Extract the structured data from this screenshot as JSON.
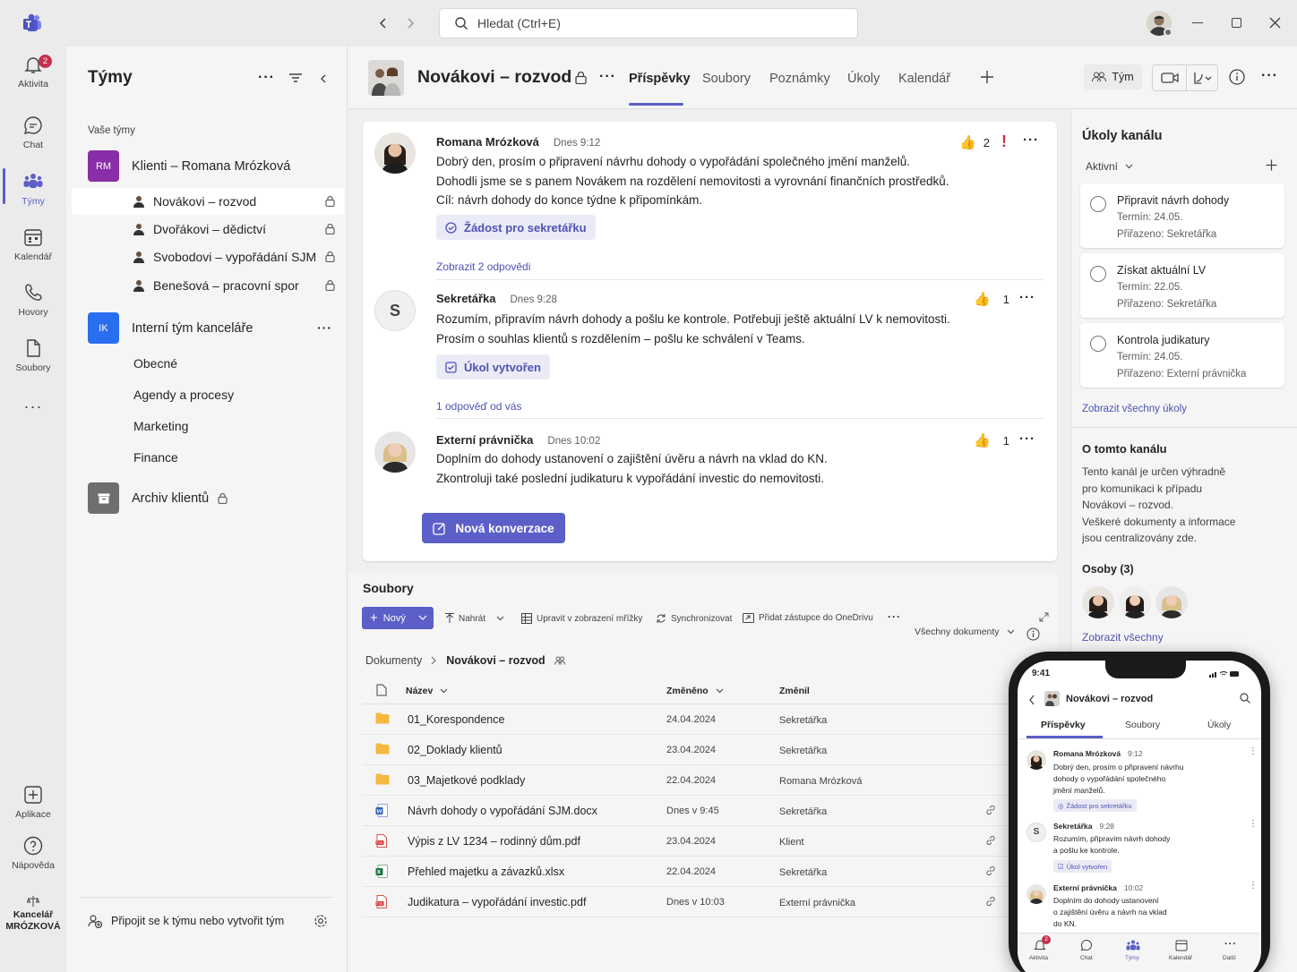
{
  "app": {
    "search_placeholder": "Hledat (Ctrl+E)"
  },
  "rail": {
    "items": [
      {
        "label": "Aktivita",
        "badge": "2"
      },
      {
        "label": "Chat"
      },
      {
        "label": "Týmy"
      },
      {
        "label": "Kalendář"
      },
      {
        "label": "Hovory"
      },
      {
        "label": "Soubory"
      },
      {
        "label": "Aplikace"
      },
      {
        "label": "Nápověda"
      }
    ],
    "org_line1": "Kancelář",
    "org_line2": "MRÓZKOVÁ"
  },
  "teams": {
    "title": "Týmy",
    "section_label": "Vaše týmy",
    "team1": {
      "initials": "RM",
      "name": "Klienti – Romana Mrózková",
      "channels": [
        "Novákovi – rozvod",
        "Dvořákovi – dědictví",
        "Svobodovi – vypořádání SJM",
        "Benešová – pracovní spor"
      ]
    },
    "team2": {
      "initials": "IK",
      "name": "Interní tým kanceláře",
      "channels": [
        "Obecné",
        "Agendy a procesy",
        "Marketing",
        "Finance"
      ]
    },
    "team3": {
      "name": "Archiv klientů"
    },
    "footer": "Připojit se k týmu nebo vytvořit tým"
  },
  "channel": {
    "name": "Novákovi – rozvod",
    "tabs": [
      "Příspěvky",
      "Soubory",
      "Poznámky",
      "Úkoly",
      "Kalendář"
    ],
    "team_button": "Tým"
  },
  "posts": [
    {
      "author": "Romana Mrózková",
      "time": "Dnes 9:12",
      "lines": [
        "Dobrý den, prosím o připravení návrhu dohody o vypořádání společného jmění manželů.",
        "Dohodli jsme se s panem Novákem na rozdělení nemovitosti a vyrovnání finančních prostředků.",
        "Cíl: návrh dohody do konce týdne k připomínkám."
      ],
      "chip": "Žádost pro sekretářku",
      "reactions": "2",
      "replies": "Zobrazit 2 odpovědi"
    },
    {
      "author": "Sekretářka",
      "initial": "S",
      "time": "Dnes 9:28",
      "lines": [
        "Rozumím, připravím návrh dohody a pošlu ke kontrole. Potřebuji ještě aktuální LV k nemovitosti.",
        "Prosím o souhlas klientů s rozdělením – pošlu ke schválení v Teams."
      ],
      "chip": "Úkol vytvořen",
      "reactions": "1",
      "replies": "1 odpověď od vás"
    },
    {
      "author": "Externí právnička",
      "time": "Dnes 10:02",
      "lines": [
        "Doplním do dohody ustanovení o zajištění úvěru a návrh na vklad do KN.",
        "Zkontroluji také poslední judikaturu k vypořádání investic do nemovitosti."
      ],
      "reactions": "1"
    }
  ],
  "new_conversation": "Nová konverzace",
  "files": {
    "title": "Soubory",
    "toolbar": {
      "new": "Nový",
      "upload": "Nahrát",
      "grid": "Upravit v zobrazení mřížky",
      "sync": "Synchronizovat",
      "shortcut": "Přidat zástupce do OneDrivu",
      "view": "Všechny dokumenty"
    },
    "breadcrumb": {
      "root": "Dokumenty",
      "current": "Novákovi – rozvod"
    },
    "columns": {
      "name": "Název",
      "modified": "Změněno",
      "modified_by": "Změnil"
    },
    "rows": [
      {
        "name": "01_Korespondence",
        "modified": "24.04.2024",
        "by": "Sekretářka",
        "type": "folder"
      },
      {
        "name": "02_Doklady klientů",
        "modified": "23.04.2024",
        "by": "Sekretářka",
        "type": "folder"
      },
      {
        "name": "03_Majetkové podklady",
        "modified": "22.04.2024",
        "by": "Romana Mrózková",
        "type": "folder"
      },
      {
        "name": "Návrh dohody o vypořádání SJM.docx",
        "modified": "Dnes v 9:45",
        "by": "Sekretářka",
        "type": "word"
      },
      {
        "name": "Výpis z LV 1234 – rodinný dům.pdf",
        "modified": "23.04.2024",
        "by": "Klient",
        "type": "pdf"
      },
      {
        "name": "Přehled majetku a závazků.xlsx",
        "modified": "22.04.2024",
        "by": "Sekretářka",
        "type": "excel"
      },
      {
        "name": "Judikatura – vypořádání investic.pdf",
        "modified": "Dnes v 10:03",
        "by": "Externí právnička",
        "type": "pdf"
      }
    ]
  },
  "tasks_panel": {
    "title": "Úkoly kanálu",
    "filter": "Aktivní",
    "tasks": [
      {
        "title": "Připravit návrh dohody",
        "due": "Termín: 24.05.",
        "assigned": "Přiřazeno: Sekretářka"
      },
      {
        "title": "Získat aktuální LV",
        "due": "Termín: 22.05.",
        "assigned": "Přiřazeno: Sekretářka"
      },
      {
        "title": "Kontrola judikatury",
        "due": "Termín: 24.05.",
        "assigned": "Přiřazeno: Externí právnička"
      }
    ],
    "show_all": "Zobrazit všechny úkoly"
  },
  "about": {
    "title": "O tomto kanálu",
    "lines": [
      "Tento kanál je určen výhradně",
      "pro komunikaci k případu",
      "Novákovi – rozvod.",
      "Veškeré dokumenty a informace",
      "jsou centralizovány zde."
    ],
    "people_label": "Osoby (3)",
    "show_all": "Zobrazit všechny"
  },
  "phone": {
    "time": "9:41",
    "channel": "Novákovi – rozvod",
    "tabs": [
      "Příspěvky",
      "Soubory",
      "Úkoly"
    ],
    "posts": [
      {
        "author": "Romana Mrózková",
        "time": "9:12",
        "lines": [
          "Dobrý den, prosím o připravení návrhu",
          "dohody o vypořádání společného",
          "jmění manželů."
        ],
        "chip": "Žádost pro sekretářku"
      },
      {
        "author": "Sekretářka",
        "time": "9:28",
        "lines": [
          "Rozumím, připravím návrh dohody",
          "a pošlu ke kontrole."
        ],
        "chip": "Úkol vytvořen"
      },
      {
        "author": "Externí právnička",
        "time": "10:02",
        "lines": [
          "Doplním do dohody ustanovení",
          "o zajištění úvěru a návrh na vklad",
          "do KN."
        ]
      }
    ],
    "nav": [
      "Aktivita",
      "Chat",
      "Týmy",
      "Kalendář",
      "Další"
    ],
    "badge": "2"
  },
  "colors": {
    "brand": "#5b5fc7",
    "team1": "#8a2da8",
    "team2": "#2a6ef0",
    "archive": "#6e6e6e"
  }
}
